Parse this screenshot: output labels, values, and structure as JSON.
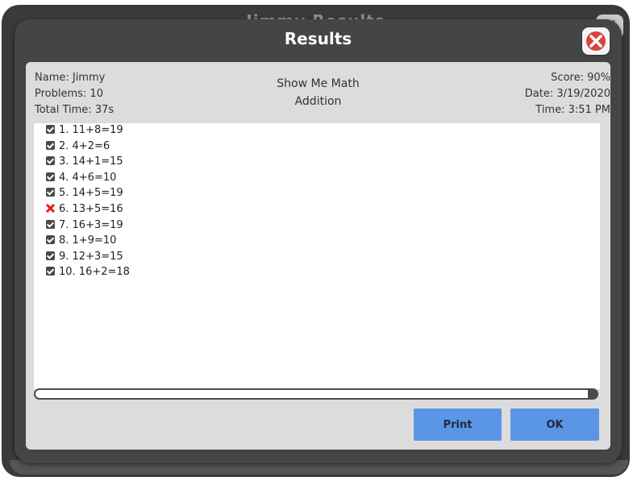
{
  "background_dialog": {
    "title": "Jimmy Results"
  },
  "dialog": {
    "title": "Results",
    "close_icon": "close-x-icon"
  },
  "info": {
    "name": "Name: Jimmy",
    "problems": "Problems: 10",
    "total_time": "Total Time: 37s",
    "app": "Show Me Math",
    "operation": "Addition",
    "score": "Score: 90%",
    "date": "Date: 3/19/2020",
    "time": "Time: 3:51 PM"
  },
  "problems": [
    {
      "text": "1. 11+8=19",
      "status": "correct"
    },
    {
      "text": "2. 4+2=6",
      "status": "correct"
    },
    {
      "text": "3. 14+1=15",
      "status": "correct"
    },
    {
      "text": "4. 4+6=10",
      "status": "correct"
    },
    {
      "text": "5. 14+5=19",
      "status": "correct"
    },
    {
      "text": "6. 13+5=16",
      "status": "incorrect"
    },
    {
      "text": "7. 16+3=19",
      "status": "correct"
    },
    {
      "text": "8. 1+9=10",
      "status": "correct"
    },
    {
      "text": "9. 12+3=15",
      "status": "correct"
    },
    {
      "text": "10. 16+2=18",
      "status": "correct"
    }
  ],
  "buttons": {
    "print": "Print",
    "ok": "OK"
  },
  "colors": {
    "button": "#5b95e6",
    "dialog": "#444546",
    "panel": "#dcdcdc",
    "incorrect": "#e12020"
  }
}
